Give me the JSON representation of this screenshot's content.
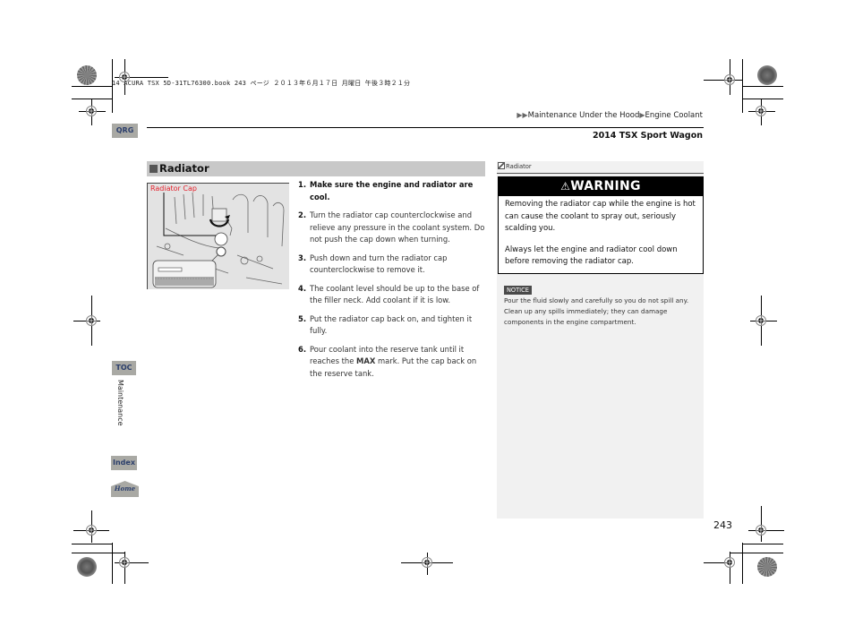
{
  "print_header": "14 ACURA TSX 5D-31TL76300.book  243 ページ  ２０１３年６月１７日  月曜日  午後３時２１分",
  "header": {
    "breadcrumb": [
      {
        "icon": "double-triangle-icon",
        "label": "Maintenance Under the Hood"
      },
      {
        "icon": "triangle-icon",
        "label": "Engine Coolant"
      }
    ],
    "vehicle_title": "2014 TSX Sport Wagon"
  },
  "side_tabs": {
    "qrg": "QRG",
    "toc": "TOC",
    "section": "Maintenance",
    "index": "Index",
    "home": "Home"
  },
  "main": {
    "section_title": "Radiator",
    "figure_label": "Radiator Cap",
    "steps": [
      {
        "num": "1.",
        "text": "Make sure the engine and radiator are cool."
      },
      {
        "num": "2.",
        "text": "Turn the radiator cap counterclockwise and relieve any pressure in the coolant system. Do not push the cap down when turning."
      },
      {
        "num": "3.",
        "text": "Push down and turn the radiator cap counterclockwise to remove it."
      },
      {
        "num": "4.",
        "text": "The coolant level should be up to the base of the filler neck. Add coolant if it is low."
      },
      {
        "num": "5.",
        "text": "Put the radiator cap back on, and tighten it fully."
      },
      {
        "num": "6.",
        "text_before": "Pour coolant into the reserve tank until it reaches the ",
        "bold": "MAX",
        "text_after": " mark. Put the cap back on the reserve tank."
      }
    ]
  },
  "sidebar": {
    "ref_label": "Radiator",
    "warning": {
      "title": "WARNING",
      "paragraphs": [
        "Removing the radiator cap while the engine is hot can cause the coolant to spray out, seriously scalding you.",
        "Always let the engine and radiator cool down before removing the radiator cap."
      ]
    },
    "notice": {
      "badge": "NOTICE",
      "text": "Pour the fluid slowly and carefully so you do not spill any. Clean up any spills immediately; they can damage components in the engine compartment."
    }
  },
  "page_number": "243"
}
